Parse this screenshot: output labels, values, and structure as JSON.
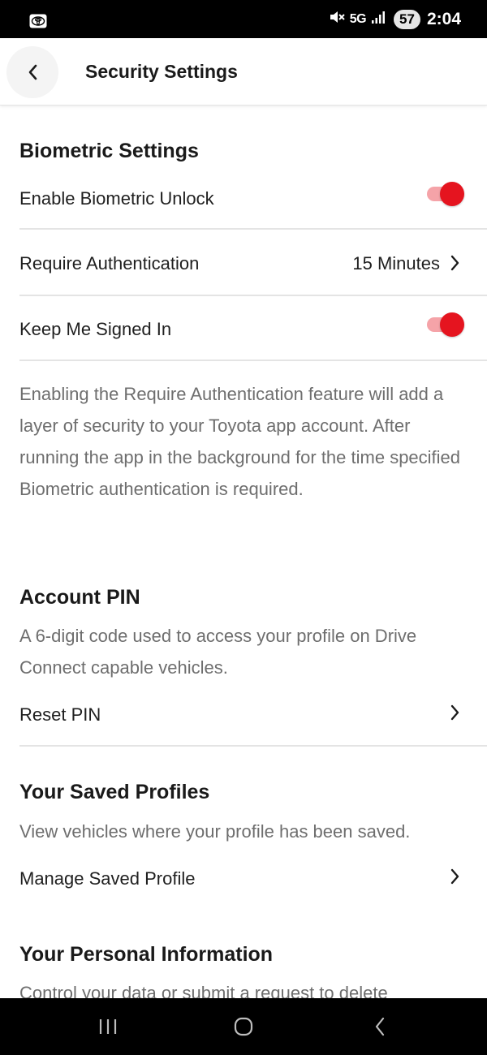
{
  "status_bar": {
    "network": "5G",
    "battery": "57",
    "time": "2:04"
  },
  "header": {
    "title": "Security Settings"
  },
  "biometric": {
    "title": "Biometric Settings",
    "enable_biometric_label": "Enable Biometric Unlock",
    "enable_biometric_on": true,
    "require_auth_label": "Require Authentication",
    "require_auth_value": "15 Minutes",
    "keep_signed_in_label": "Keep Me Signed In",
    "keep_signed_in_on": true,
    "description": "Enabling the Require Authentication feature will add a layer of security to your Toyota app account. After running the app in the background for the time specified Biometric authentication is required."
  },
  "account_pin": {
    "title": "Account PIN",
    "description": "A 6-digit code used to access your profile on Drive Connect capable vehicles.",
    "reset_label": "Reset PIN"
  },
  "saved_profiles": {
    "title": "Your Saved Profiles",
    "description": "View vehicles where your profile has been saved.",
    "manage_label": "Manage Saved Profile"
  },
  "personal_info": {
    "title": "Your Personal Information",
    "description": "Control your data or submit a request to delete"
  },
  "colors": {
    "accent": "#e5141f",
    "accent_track": "#f5a3a8",
    "text_primary": "#1f1f1f",
    "text_secondary": "#6e6e6e"
  }
}
